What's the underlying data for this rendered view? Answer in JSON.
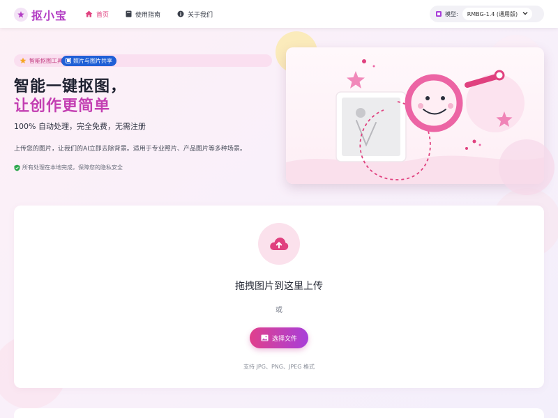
{
  "header": {
    "logo_text": "抠小宝",
    "nav": [
      {
        "label": "首页",
        "icon": "home-icon",
        "active": true
      },
      {
        "label": "使用指南",
        "icon": "book-icon",
        "active": false
      },
      {
        "label": "关于我们",
        "icon": "info-icon",
        "active": false
      }
    ],
    "model_label": "模型:",
    "model_value": "RMBG-1.4 (通用版)"
  },
  "hero": {
    "badge_text": "智能抠图工具",
    "badge_tag": "照片与图片共享",
    "title_line1": "智能一键抠图，",
    "title_line2": "让创作更简单",
    "subtitle": "100% 自动处理，完全免费，无需注册",
    "description": "上传您的图片，让我们的AI立即去除背景。适用于专业照片、产品图片等多种场景。",
    "privacy": "所有处理在本地完成，保障您的隐私安全"
  },
  "upload": {
    "title": "拖拽图片到这里上传",
    "or_text": "或",
    "button_label": "选择文件",
    "hint": "支持 JPG、PNG、JPEG 格式"
  },
  "colors": {
    "accent_pink": "#e0417f",
    "accent_purple": "#b23cc3",
    "badge_blue": "#1f5fd6",
    "privacy_green": "#2fa84f"
  }
}
